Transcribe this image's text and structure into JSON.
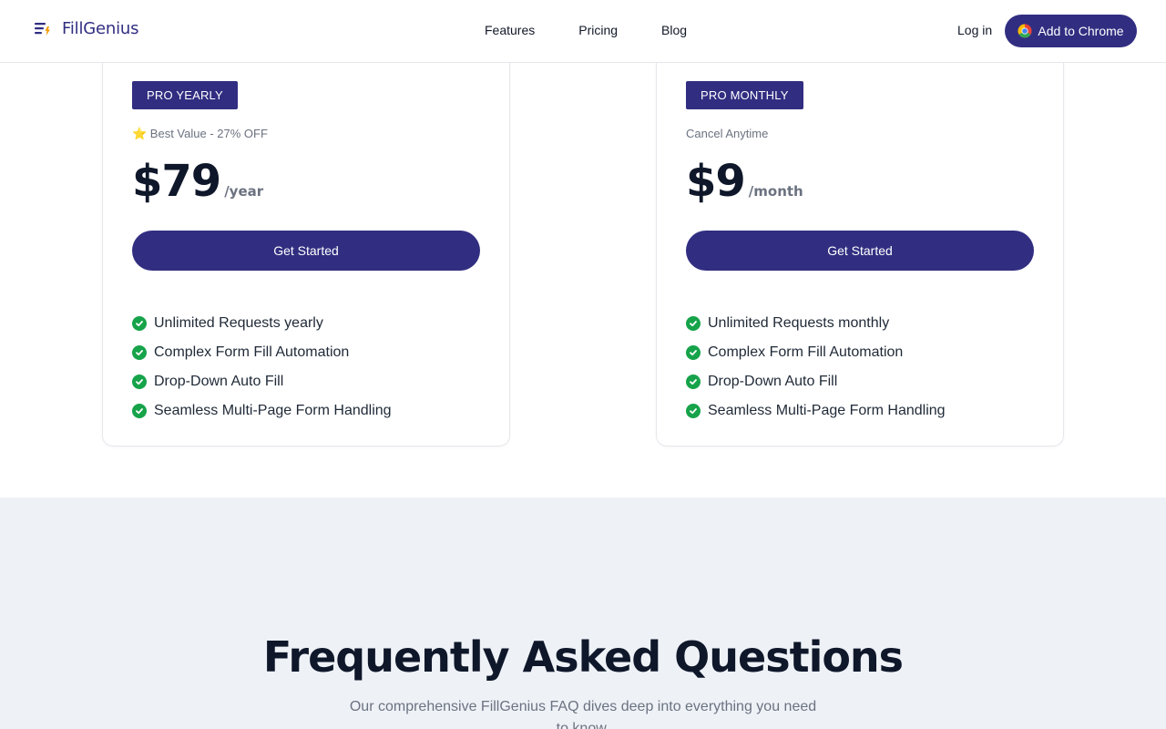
{
  "header": {
    "brand": "FillGenius",
    "nav": [
      {
        "label": "Features"
      },
      {
        "label": "Pricing"
      },
      {
        "label": "Blog"
      }
    ],
    "login_label": "Log in",
    "cta_label": "Add to Chrome"
  },
  "plans": [
    {
      "badge": "PRO YEARLY",
      "note": "⭐ Best Value - 27% OFF",
      "price": "$79",
      "period": "/year",
      "button": "Get Started",
      "features": [
        "Unlimited Requests yearly",
        "Complex Form Fill Automation",
        "Drop-Down Auto Fill",
        "Seamless Multi-Page Form Handling"
      ]
    },
    {
      "badge": "PRO MONTHLY",
      "note": "Cancel Anytime",
      "price": "$9",
      "period": "/month",
      "button": "Get Started",
      "features": [
        "Unlimited Requests monthly",
        "Complex Form Fill Automation",
        "Drop-Down Auto Fill",
        "Seamless Multi-Page Form Handling"
      ]
    }
  ],
  "faq": {
    "title": "Frequently Asked Questions",
    "subtitle": "Our comprehensive FillGenius FAQ dives deep into everything you need to know."
  },
  "colors": {
    "brand": "#312e81",
    "check": "#16a34a",
    "faq_bg": "#eef2f7"
  },
  "icons": {
    "logo": "menu-bolt-icon",
    "chrome": "chrome-icon",
    "feature": "check-circle-icon"
  }
}
